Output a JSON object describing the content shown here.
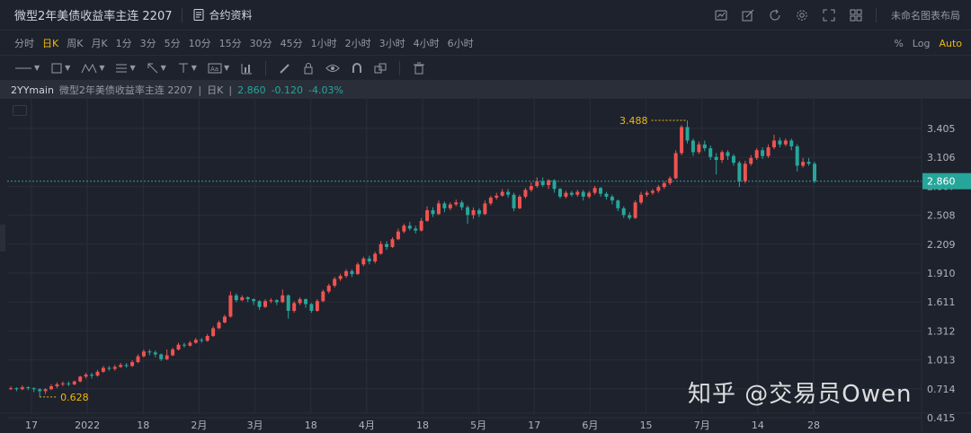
{
  "header": {
    "symbol": "微型2年美债收益率主连 2207",
    "contract_info": "合约资料",
    "layout_name": "未命名图表布局"
  },
  "timeframes": [
    "分时",
    "日K",
    "周K",
    "月K",
    "1分",
    "3分",
    "5分",
    "10分",
    "15分",
    "30分",
    "45分",
    "1小时",
    "2小时",
    "3小时",
    "4小时",
    "6小时"
  ],
  "active_timeframe": "日K",
  "scale_options": [
    "%",
    "Log",
    "Auto"
  ],
  "active_scale": "Auto",
  "legend": {
    "code": "2YYmain",
    "name": "微型2年美债收益率主连 2207",
    "period": "日K",
    "last": "2.860",
    "change": "-0.120",
    "change_pct": "-4.03%"
  },
  "watermark": "知乎 @交易员Owen",
  "colors": {
    "up": "#ef5350",
    "down": "#26a69a",
    "last_price_bg": "#26a69a",
    "annotation": "#f0b90b",
    "background": "#1e222d",
    "grid": "#2a2e39"
  },
  "chart_data": {
    "type": "candlestick",
    "title": "微型2年美债收益率主连 2207",
    "y_ticks": [
      "3.405",
      "3.106",
      "2.807",
      "2.508",
      "2.209",
      "1.910",
      "1.611",
      "1.312",
      "1.013",
      "0.714",
      "0.415"
    ],
    "ylim": [
      0.415,
      3.6
    ],
    "x_ticks": [
      "17",
      "2022",
      "18",
      "2月",
      "3月",
      "18",
      "4月",
      "18",
      "5月",
      "17",
      "6月",
      "15",
      "7月",
      "14",
      "28"
    ],
    "last_price": "2.860",
    "high_label": "3.488",
    "low_label": "0.628",
    "grid": true,
    "candles": [
      [
        0.72,
        0.72,
        0.74,
        0.7
      ],
      [
        0.72,
        0.71,
        0.73,
        0.69
      ],
      [
        0.71,
        0.73,
        0.75,
        0.7
      ],
      [
        0.73,
        0.72,
        0.74,
        0.7
      ],
      [
        0.72,
        0.71,
        0.73,
        0.68
      ],
      [
        0.71,
        0.69,
        0.72,
        0.63
      ],
      [
        0.69,
        0.71,
        0.72,
        0.66
      ],
      [
        0.71,
        0.74,
        0.76,
        0.7
      ],
      [
        0.74,
        0.76,
        0.78,
        0.72
      ],
      [
        0.76,
        0.77,
        0.79,
        0.74
      ],
      [
        0.77,
        0.76,
        0.79,
        0.74
      ],
      [
        0.76,
        0.79,
        0.8,
        0.75
      ],
      [
        0.79,
        0.84,
        0.85,
        0.78
      ],
      [
        0.84,
        0.86,
        0.88,
        0.82
      ],
      [
        0.86,
        0.85,
        0.88,
        0.82
      ],
      [
        0.85,
        0.89,
        0.91,
        0.84
      ],
      [
        0.89,
        0.93,
        0.95,
        0.88
      ],
      [
        0.93,
        0.92,
        0.95,
        0.9
      ],
      [
        0.92,
        0.94,
        0.96,
        0.9
      ],
      [
        0.94,
        0.96,
        0.98,
        0.93
      ],
      [
        0.96,
        0.95,
        0.98,
        0.93
      ],
      [
        0.95,
        0.99,
        1.01,
        0.94
      ],
      [
        0.99,
        1.05,
        1.07,
        0.98
      ],
      [
        1.05,
        1.1,
        1.12,
        1.04
      ],
      [
        1.1,
        1.09,
        1.12,
        1.06
      ],
      [
        1.09,
        1.07,
        1.11,
        1.04
      ],
      [
        1.07,
        1.02,
        1.08,
        1.0
      ],
      [
        1.02,
        1.06,
        1.12,
        1.01
      ],
      [
        1.06,
        1.12,
        1.14,
        1.05
      ],
      [
        1.12,
        1.17,
        1.19,
        1.11
      ],
      [
        1.17,
        1.16,
        1.19,
        1.14
      ],
      [
        1.16,
        1.19,
        1.21,
        1.15
      ],
      [
        1.19,
        1.22,
        1.24,
        1.18
      ],
      [
        1.22,
        1.21,
        1.24,
        1.19
      ],
      [
        1.21,
        1.26,
        1.28,
        1.2
      ],
      [
        1.26,
        1.34,
        1.36,
        1.25
      ],
      [
        1.34,
        1.4,
        1.42,
        1.33
      ],
      [
        1.4,
        1.46,
        1.48,
        1.39
      ],
      [
        1.46,
        1.68,
        1.72,
        1.45
      ],
      [
        1.68,
        1.63,
        1.7,
        1.61
      ],
      [
        1.63,
        1.66,
        1.68,
        1.62
      ],
      [
        1.66,
        1.64,
        1.67,
        1.61
      ],
      [
        1.64,
        1.62,
        1.65,
        1.58
      ],
      [
        1.62,
        1.56,
        1.63,
        1.53
      ],
      [
        1.56,
        1.62,
        1.64,
        1.55
      ],
      [
        1.62,
        1.63,
        1.65,
        1.6
      ],
      [
        1.63,
        1.61,
        1.64,
        1.58
      ],
      [
        1.61,
        1.68,
        1.74,
        1.6
      ],
      [
        1.68,
        1.52,
        1.69,
        1.44
      ],
      [
        1.52,
        1.6,
        1.62,
        1.5
      ],
      [
        1.6,
        1.64,
        1.66,
        1.58
      ],
      [
        1.64,
        1.59,
        1.65,
        1.55
      ],
      [
        1.59,
        1.52,
        1.6,
        1.5
      ],
      [
        1.52,
        1.62,
        1.64,
        1.51
      ],
      [
        1.62,
        1.72,
        1.74,
        1.61
      ],
      [
        1.72,
        1.78,
        1.8,
        1.7
      ],
      [
        1.78,
        1.85,
        1.87,
        1.76
      ],
      [
        1.85,
        1.88,
        1.9,
        1.83
      ],
      [
        1.88,
        1.93,
        1.95,
        1.86
      ],
      [
        1.93,
        1.9,
        1.95,
        1.87
      ],
      [
        1.9,
        2.0,
        2.02,
        1.89
      ],
      [
        2.0,
        2.06,
        2.08,
        1.98
      ],
      [
        2.06,
        2.03,
        2.09,
        2.0
      ],
      [
        2.03,
        2.11,
        2.13,
        2.01
      ],
      [
        2.11,
        2.21,
        2.24,
        2.1
      ],
      [
        2.21,
        2.18,
        2.24,
        2.15
      ],
      [
        2.18,
        2.26,
        2.28,
        2.17
      ],
      [
        2.26,
        2.34,
        2.37,
        2.25
      ],
      [
        2.34,
        2.4,
        2.42,
        2.32
      ],
      [
        2.4,
        2.37,
        2.44,
        2.35
      ],
      [
        2.37,
        2.35,
        2.4,
        2.32
      ],
      [
        2.35,
        2.45,
        2.48,
        2.34
      ],
      [
        2.45,
        2.56,
        2.6,
        2.44
      ],
      [
        2.56,
        2.52,
        2.59,
        2.49
      ],
      [
        2.52,
        2.63,
        2.66,
        2.51
      ],
      [
        2.63,
        2.58,
        2.65,
        2.54
      ],
      [
        2.58,
        2.62,
        2.64,
        2.56
      ],
      [
        2.62,
        2.64,
        2.67,
        2.6
      ],
      [
        2.64,
        2.59,
        2.66,
        2.56
      ],
      [
        2.59,
        2.51,
        2.61,
        2.42
      ],
      [
        2.51,
        2.56,
        2.59,
        2.47
      ],
      [
        2.56,
        2.52,
        2.58,
        2.49
      ],
      [
        2.52,
        2.63,
        2.66,
        2.51
      ],
      [
        2.63,
        2.69,
        2.71,
        2.61
      ],
      [
        2.69,
        2.71,
        2.74,
        2.67
      ],
      [
        2.71,
        2.75,
        2.78,
        2.7
      ],
      [
        2.75,
        2.72,
        2.78,
        2.69
      ],
      [
        2.72,
        2.58,
        2.74,
        2.55
      ],
      [
        2.58,
        2.7,
        2.72,
        2.57
      ],
      [
        2.7,
        2.77,
        2.79,
        2.68
      ],
      [
        2.77,
        2.81,
        2.85,
        2.75
      ],
      [
        2.81,
        2.86,
        2.9,
        2.79
      ],
      [
        2.86,
        2.82,
        2.9,
        2.8
      ],
      [
        2.82,
        2.87,
        2.88,
        2.78
      ],
      [
        2.87,
        2.78,
        2.88,
        2.74
      ],
      [
        2.78,
        2.7,
        2.79,
        2.68
      ],
      [
        2.7,
        2.74,
        2.76,
        2.68
      ],
      [
        2.74,
        2.72,
        2.76,
        2.7
      ],
      [
        2.72,
        2.75,
        2.77,
        2.7
      ],
      [
        2.75,
        2.7,
        2.77,
        2.66
      ],
      [
        2.7,
        2.74,
        2.76,
        2.68
      ],
      [
        2.74,
        2.79,
        2.81,
        2.72
      ],
      [
        2.79,
        2.73,
        2.8,
        2.7
      ],
      [
        2.73,
        2.7,
        2.75,
        2.67
      ],
      [
        2.7,
        2.66,
        2.72,
        2.62
      ],
      [
        2.66,
        2.58,
        2.67,
        2.55
      ],
      [
        2.58,
        2.51,
        2.6,
        2.48
      ],
      [
        2.51,
        2.48,
        2.54,
        2.46
      ],
      [
        2.48,
        2.64,
        2.66,
        2.47
      ],
      [
        2.64,
        2.72,
        2.75,
        2.62
      ],
      [
        2.72,
        2.74,
        2.76,
        2.7
      ],
      [
        2.74,
        2.76,
        2.78,
        2.72
      ],
      [
        2.76,
        2.8,
        2.82,
        2.74
      ],
      [
        2.8,
        2.84,
        2.86,
        2.78
      ],
      [
        2.84,
        2.89,
        2.91,
        2.82
      ],
      [
        2.89,
        3.15,
        3.18,
        2.88
      ],
      [
        3.15,
        3.42,
        3.44,
        3.13
      ],
      [
        3.42,
        3.28,
        3.488,
        3.25
      ],
      [
        3.28,
        3.16,
        3.3,
        3.12
      ],
      [
        3.16,
        3.24,
        3.27,
        3.14
      ],
      [
        3.24,
        3.2,
        3.28,
        3.17
      ],
      [
        3.2,
        3.11,
        3.23,
        3.08
      ],
      [
        3.11,
        3.08,
        3.15,
        2.93
      ],
      [
        3.08,
        3.16,
        3.18,
        3.05
      ],
      [
        3.16,
        3.12,
        3.18,
        3.08
      ],
      [
        3.12,
        3.05,
        3.14,
        3.02
      ],
      [
        3.05,
        2.86,
        3.07,
        2.8
      ],
      [
        2.86,
        3.04,
        3.07,
        2.84
      ],
      [
        3.04,
        3.1,
        3.13,
        3.02
      ],
      [
        3.1,
        3.18,
        3.2,
        3.08
      ],
      [
        3.18,
        3.12,
        3.21,
        3.09
      ],
      [
        3.12,
        3.21,
        3.24,
        3.1
      ],
      [
        3.21,
        3.28,
        3.34,
        3.19
      ],
      [
        3.28,
        3.24,
        3.31,
        3.21
      ],
      [
        3.24,
        3.28,
        3.3,
        3.22
      ],
      [
        3.28,
        3.22,
        3.3,
        3.18
      ],
      [
        3.22,
        3.02,
        3.24,
        2.96
      ],
      [
        3.02,
        3.06,
        3.1,
        3.0
      ],
      [
        3.06,
        3.04,
        3.1,
        3.02
      ],
      [
        3.04,
        2.86,
        3.06,
        2.84
      ]
    ]
  }
}
